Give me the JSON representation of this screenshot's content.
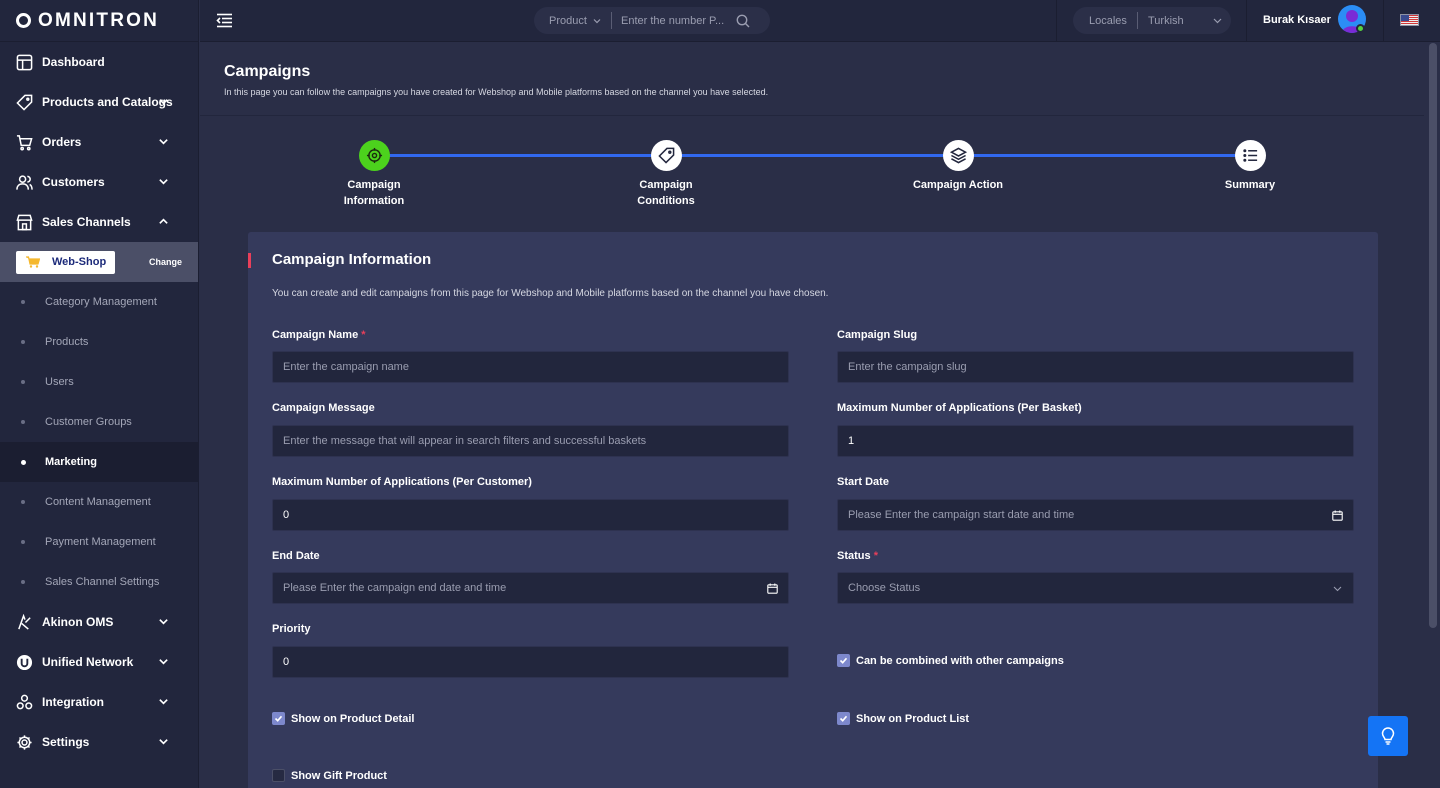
{
  "brand": {
    "name": "OMNITRON"
  },
  "sidebar": {
    "items": [
      {
        "label": "Dashboard"
      },
      {
        "label": "Products and Catalogs"
      },
      {
        "label": "Orders"
      },
      {
        "label": "Customers"
      },
      {
        "label": "Sales Channels"
      },
      {
        "label": "Akinon OMS"
      },
      {
        "label": "Unified Network"
      },
      {
        "label": "Integration"
      },
      {
        "label": "Settings"
      }
    ],
    "channel": {
      "name": "Web-Shop",
      "change_label": "Change"
    },
    "sub_items": [
      {
        "label": "Category Management"
      },
      {
        "label": "Products"
      },
      {
        "label": "Users"
      },
      {
        "label": "Customer Groups"
      },
      {
        "label": "Marketing"
      },
      {
        "label": "Content Management"
      },
      {
        "label": "Payment Management"
      },
      {
        "label": "Sales Channel Settings"
      }
    ]
  },
  "topbar": {
    "search_type": "Product",
    "search_placeholder": "Enter the number P...",
    "locale_label": "Locales",
    "locale_value": "Turkish",
    "user_name": "Burak Kısaer"
  },
  "page": {
    "title": "Campaigns",
    "description": "In this page you can follow the campaigns you have created for Webshop and Mobile platforms based on the channel you have selected."
  },
  "steps": [
    {
      "line1": "Campaign",
      "line2": "Information"
    },
    {
      "line1": "Campaign",
      "line2": "Conditions"
    },
    {
      "line1": "Campaign Action",
      "line2": ""
    },
    {
      "line1": "Summary",
      "line2": ""
    }
  ],
  "form": {
    "title": "Campaign Information",
    "description": "You can create and edit campaigns from this page for Webshop and Mobile platforms based on the channel you have chosen.",
    "required_mark": "*",
    "campaign_name": {
      "label": "Campaign Name",
      "placeholder": "Enter the campaign name"
    },
    "campaign_slug": {
      "label": "Campaign Slug",
      "placeholder": "Enter the campaign slug"
    },
    "campaign_message": {
      "label": "Campaign Message",
      "placeholder": "Enter the message that will appear in search filters and successful baskets"
    },
    "max_per_basket": {
      "label": "Maximum Number of Applications (Per Basket)",
      "value": "1"
    },
    "max_per_customer": {
      "label": "Maximum Number of Applications (Per Customer)",
      "value": "0"
    },
    "start_date": {
      "label": "Start Date",
      "placeholder": "Please Enter the campaign start date and time"
    },
    "end_date": {
      "label": "End Date",
      "placeholder": "Please Enter the campaign end date and time"
    },
    "status": {
      "label": "Status",
      "placeholder": "Choose Status"
    },
    "priority": {
      "label": "Priority",
      "value": "0"
    },
    "checks": {
      "combinable": {
        "label": "Can be combined with other campaigns",
        "checked": true
      },
      "show_detail": {
        "label": "Show on Product Detail",
        "checked": true
      },
      "show_list": {
        "label": "Show on Product List",
        "checked": true
      },
      "show_gift": {
        "label": "Show Gift Product",
        "checked": false
      }
    }
  },
  "colors": {
    "accent": "#3168ef",
    "active_step": "#4cd21d",
    "required": "#e93f5a",
    "help_button": "#1474f5"
  }
}
